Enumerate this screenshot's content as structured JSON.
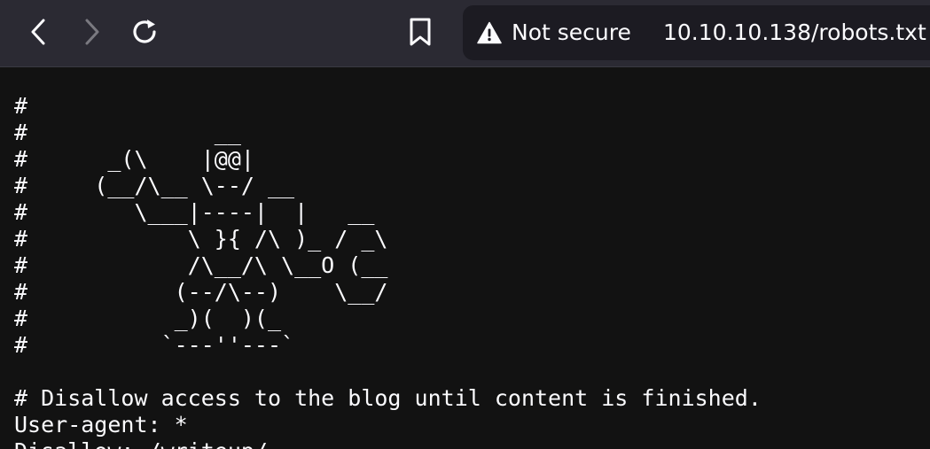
{
  "toolbar": {
    "back_icon": "chevron-left-icon",
    "forward_icon": "chevron-right-icon",
    "reload_icon": "reload-icon",
    "bookmark_icon": "bookmark-icon"
  },
  "urlbar": {
    "security_icon": "warning-triangle-icon",
    "security_label": "Not secure",
    "url": "10.10.10.138/robots.txt"
  },
  "page": {
    "text": "#\n#              __\n#      _(\\    |@@|\n#     (__/\\__ \\--/ __\n#        \\___|----|  |   __\n#            \\ }{ /\\ )_ / _\\\n#            /\\__/\\ \\__O (__\n#           (--/\\--)    \\__/\n#           _)(  )(_\n#          `---''---`\n\n# Disallow access to the blog until content is finished.\nUser-agent: *\nDisallow: /writeup/"
  }
}
